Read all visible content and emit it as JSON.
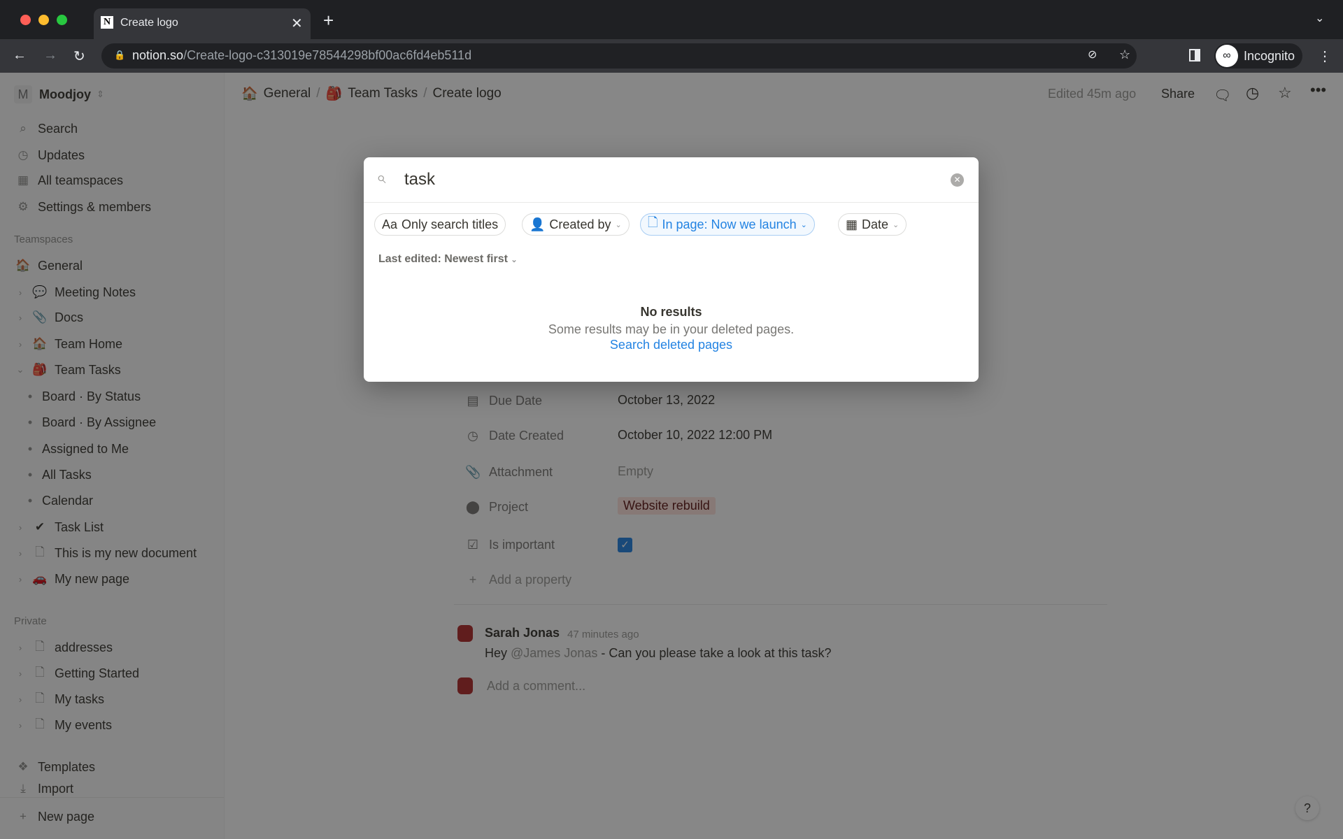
{
  "browser": {
    "tab_title": "Create logo",
    "url_domain": "notion.so",
    "url_path": "/Create-logo-c313019e78544298bf00ac6fd4eb511d",
    "profile": "Incognito"
  },
  "workspace": {
    "name": "Moodjoy",
    "initial": "M"
  },
  "sidebar": {
    "top": [
      {
        "label": "Search",
        "icon": "search-icon"
      },
      {
        "label": "Updates",
        "icon": "clock-icon"
      },
      {
        "label": "All teamspaces",
        "icon": "grid-icon"
      },
      {
        "label": "Settings & members",
        "icon": "gear-icon"
      }
    ],
    "teamspaces_label": "Teamspaces",
    "general": "General",
    "teamspace_items": [
      {
        "label": "Meeting Notes",
        "emoji": "💬"
      },
      {
        "label": "Docs",
        "emoji": "📎"
      },
      {
        "label": "Team Home",
        "emoji": "🏠"
      },
      {
        "label": "Team Tasks",
        "emoji": "🎒"
      }
    ],
    "subitems": [
      "Board · By Status",
      "Board · By Assignee",
      "Assigned to Me",
      "All Tasks",
      "Calendar"
    ],
    "more_items": [
      {
        "label": "Task List",
        "emoji": "✔"
      },
      {
        "label": "This is my new document",
        "emoji": "🗋"
      },
      {
        "label": "My new page",
        "emoji": "🚗"
      }
    ],
    "private_label": "Private",
    "private_items": [
      "addresses",
      "Getting Started",
      "My tasks",
      "My events"
    ],
    "templates": "Templates",
    "import": "Import",
    "new_page": "New page"
  },
  "header": {
    "breadcrumb": [
      "General",
      "Team Tasks",
      "Create logo"
    ],
    "edited": "Edited 45m ago",
    "share": "Share"
  },
  "properties": [
    {
      "label": "Due Date",
      "value": "October 13, 2022",
      "icon": "calendar-icon"
    },
    {
      "label": "Date Created",
      "value": "October 10, 2022 12:00 PM",
      "icon": "clock-icon"
    },
    {
      "label": "Attachment",
      "value": "Empty",
      "icon": "paperclip-icon"
    },
    {
      "label": "Project",
      "value": "Website rebuild",
      "icon": "relation-icon"
    },
    {
      "label": "Is important",
      "value": "",
      "icon": "checkbox-icon",
      "checked": true
    }
  ],
  "add_property": "Add a property",
  "comment": {
    "author": "Sarah Jonas",
    "time": "47 minutes ago",
    "mention": "@James Jonas",
    "text": " - Can you please take a look at this task?",
    "pre": "Hey ",
    "placeholder": "Add a comment..."
  },
  "search": {
    "query": "task",
    "filters": {
      "titles": "Only search titles",
      "titles_prefix": "Aa",
      "created_by": "Created by",
      "in_page": "In page: Now we launch",
      "date": "Date"
    },
    "sort": "Last edited: Newest first",
    "no_results": "No results",
    "hint": "Some results may be in your deleted pages.",
    "link": "Search deleted pages"
  },
  "colors": {
    "accent": "#2383e2",
    "project_tag": "#ffe2dd"
  }
}
